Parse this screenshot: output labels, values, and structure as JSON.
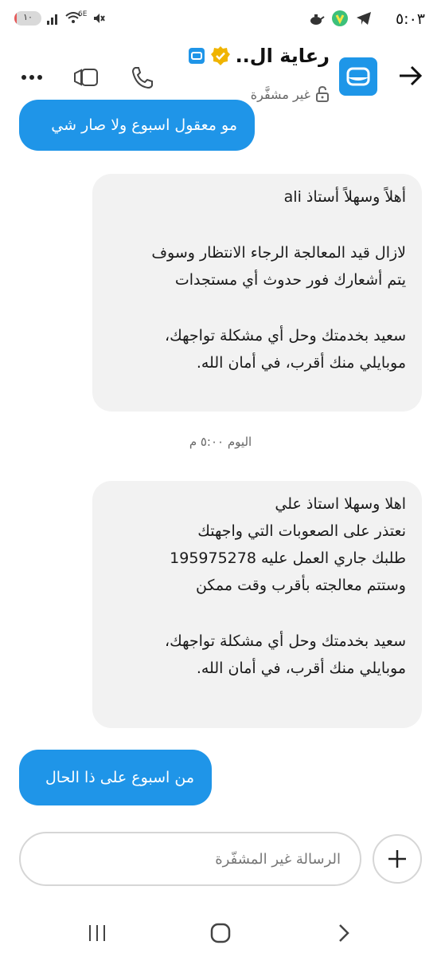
{
  "status_bar": {
    "time": "٥:٠٣",
    "battery_level": "١٠",
    "battery_fraction": 0.1,
    "network_label": "6E",
    "icons": [
      "signal-icon",
      "wifi-icon",
      "mute-icon",
      "telegram-icon",
      "app-icon",
      "teapot-icon"
    ]
  },
  "header": {
    "title": "رعاية ال..",
    "subtitle": "غير مشفَّرة",
    "avatar_icon": "mobily-logo-icon",
    "colors": {
      "accent": "#1f95e8",
      "verified": "#f0b400"
    }
  },
  "messages": {
    "out_1": "مو معقول اسبوع ولا صار شي",
    "in_1": {
      "lines": [
        "أهلاً وسهلاً أستاذ ali",
        "",
        "لازال قيد المعالجة الرجاء الانتظار وسوف",
        "يتم أشعارك فور حدوث أي مستجدات",
        "",
        "سعيد بخدمتك وحل أي مشكلة تواجهك،",
        "موبايلي منك أقرب، في أمان الله."
      ]
    },
    "timestamp": "اليوم ٥:٠٠ م",
    "in_2": {
      "lines": [
        "اهلا وسهلا استاذ علي",
        "نعتذر على الصعوبات التي واجهتك",
        "طلبك جاري العمل عليه 195975278",
        "وستتم معالجته بأقرب وقت ممكن",
        "",
        "سعيد بخدمتك وحل أي مشكلة تواجهك،",
        "موبايلي منك أقرب، في أمان الله."
      ]
    },
    "out_2": "من اسبوع على ذا الحال"
  },
  "composer": {
    "placeholder": "الرسالة غير المشفّرة",
    "value": ""
  }
}
